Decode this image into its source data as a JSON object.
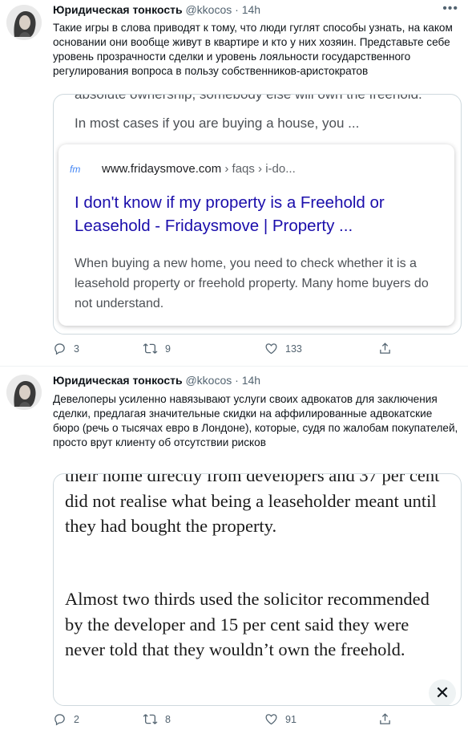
{
  "tweets": [
    {
      "author": "Юридическая тонкость",
      "handle": "@kkocos",
      "separator": "·",
      "time": "14h",
      "more_icon": "more-icon",
      "text": "Такие игры в слова приводят к тому, что люди гуглят способы узнать, на каком основании они вообще живут в квартире и кто у них хозяин. Представьте себе уровень прозрачности сделки и уровень лояльности государственного регулирования вопроса в пользу собственников-аристократов",
      "media": {
        "cut_text": "absolute ownership, somebody else will own the freehold.",
        "snippet_top": "In most cases if you are buying a house, you  ...",
        "site_logo": "fm",
        "site_url": "www.fridaysmove.com",
        "breadcrumbs": " › faqs › i-do...",
        "result_title": "I don't know if my property is a Freehold or Leasehold - Fridaysmove | Property ...",
        "result_desc": "When buying a new home, you need to check whether it is a leasehold property or freehold property. Many home buyers do not understand."
      },
      "actions": {
        "replies": "3",
        "retweets": "9",
        "likes": "133"
      }
    },
    {
      "author": "Юридическая тонкость",
      "handle": "@kkocos",
      "separator": "·",
      "time": "14h",
      "text": "Девелоперы усиленно навязывают услуги своих адвокатов для заключения сделки, предлагая значительные скидки на аффилированные адвокатские бюро (речь о тысячах евро в Лондоне), которые, судя по жалобам покупателей, просто врут клиенту об отсутствии рисков",
      "media": {
        "para1": "their home directly from developers and 37 per cent did not realise what being a leaseholder meant until they had bought the property.",
        "para2": "Almost two thirds used the solicitor recommended by the developer and 15 per cent said they were never told that they wouldn’t own the freehold.",
        "close_label": "✕"
      },
      "actions": {
        "replies": "2",
        "retweets": "8",
        "likes": "91"
      }
    }
  ],
  "colors": {
    "link": "#1a0dab",
    "muted": "#536471",
    "border": "#cfd9de"
  }
}
